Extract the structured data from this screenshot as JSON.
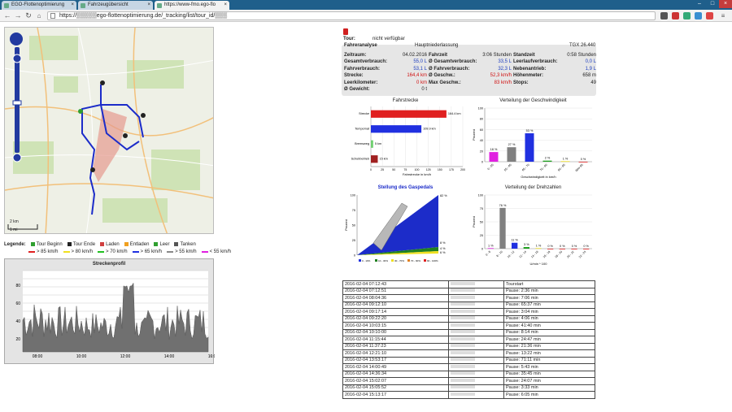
{
  "browser": {
    "tabs": [
      {
        "label": "EGO-Flottenoptimierung",
        "active": false
      },
      {
        "label": "Fahrzeugübersicht",
        "active": false
      },
      {
        "label": "https://www-fmo.ego-flo",
        "active": true
      }
    ],
    "url": "https://▒▒▒▒▒ego-flottenoptimierung.de/_tracking/list/tour_id/▒▒▒"
  },
  "map": {
    "scale_top": "2 km",
    "scale_bottom": "1 mi"
  },
  "legend": {
    "label": "Legende:",
    "items": [
      "Tour Beginn",
      "Tour Ende",
      "Laden",
      "Entladen",
      "Leer",
      "Tanken"
    ],
    "speeds": [
      {
        "label": "> 85 km/h",
        "color": "#e02020"
      },
      {
        "label": "> 80 km/h",
        "color": "#f0e020"
      },
      {
        "label": "> 70 km/h",
        "color": "#20c020"
      },
      {
        "label": "> 65 km/h",
        "color": "#2030e0"
      },
      {
        "label": "> 55 km/h",
        "color": "#888888"
      },
      {
        "label": "< 55 km/h",
        "color": "#e020e0"
      }
    ]
  },
  "profile": {
    "title": "Streckenprofil",
    "yticks": [
      "80",
      "60",
      "40",
      "20"
    ],
    "xticks": [
      "08:00",
      "10:00",
      "12:00",
      "14:00",
      "16:00"
    ]
  },
  "info": {
    "tour_label": "Tour:",
    "tour_value": "nicht verfügbar",
    "fahreranalyse": "Fahreranalyse",
    "location": "Hauptniederlassung",
    "vehicle": "TGX 26.440",
    "col1": [
      {
        "k": "Zeitraum:",
        "v": "04.02.2016",
        "c": ""
      },
      {
        "k": "Gesamtverbrauch:",
        "v": "55,0 L",
        "c": "blue"
      },
      {
        "k": "Fahrverbrauch:",
        "v": "53,1 L",
        "c": "blue"
      },
      {
        "k": "Strecke:",
        "v": "164,4 km",
        "c": "red"
      },
      {
        "k": "Leerkilometer:",
        "v": "0 km",
        "c": "red"
      },
      {
        "k": "Ø Gewicht:",
        "v": "0 t",
        "c": ""
      }
    ],
    "col2": [
      {
        "k": "Fahrzeit",
        "v": "3:06 Stunden",
        "c": ""
      },
      {
        "k": "Ø Gesamtverbrauch:",
        "v": "33,5 L",
        "c": "blue"
      },
      {
        "k": "Ø Fahrverbrauch:",
        "v": "32,3 L",
        "c": "blue"
      },
      {
        "k": "Ø Geschw.:",
        "v": "52,3 km/h",
        "c": "red"
      },
      {
        "k": "Max Geschw.:",
        "v": "83 km/h",
        "c": "red"
      }
    ],
    "col3": [
      {
        "k": "Standzeit",
        "v": "0:58 Stunden",
        "c": ""
      },
      {
        "k": "Leerlaufverbrauch:",
        "v": "0,0 L",
        "c": "blue"
      },
      {
        "k": "Nebenantrieb:",
        "v": "1,9 L",
        "c": "blue"
      },
      {
        "k": "Höhenmeter:",
        "v": "658 m",
        "c": ""
      },
      {
        "k": "Stops:",
        "v": "49",
        "c": ""
      }
    ]
  },
  "chart_data": [
    {
      "type": "bar",
      "title": "Fahrstrecke",
      "xlabel": "Fahrstrecke in km/h",
      "categories": [
        "Strecke",
        "Tempomat",
        "Bremsweg",
        "Schubbetrieb"
      ],
      "values": [
        164.4,
        109.9,
        5,
        15
      ],
      "data_labels": [
        "164.4 km",
        "109.9 km",
        "5 km",
        "15 km"
      ],
      "colors": [
        "#e02020",
        "#2030e0",
        "#70d070",
        "#a02020"
      ],
      "xlim": [
        0,
        200
      ],
      "xticks": [
        "0",
        "25",
        "50",
        "75",
        "100",
        "125",
        "150",
        "175",
        "200"
      ]
    },
    {
      "type": "bar",
      "title": "Verteilung der Geschwindigkeit",
      "xlabel": "Geschwindigkeit in km/h",
      "ylabel": "Prozent",
      "categories": [
        "0 - 55",
        "55 - 65",
        "65 - 70",
        "70 - 80",
        "80 - 85",
        "über 85"
      ],
      "values": [
        18,
        27,
        53,
        2,
        1,
        0
      ],
      "data_labels": [
        "18 %",
        "27 %",
        "53 %",
        "2 %",
        "1 %",
        "0 %"
      ],
      "colors": [
        "#e020e0",
        "#808080",
        "#2030e0",
        "#20a020",
        "#f0e020",
        "#e02020"
      ],
      "ylim": [
        0,
        100
      ],
      "yticks": [
        "0",
        "20",
        "40",
        "60",
        "80",
        "100"
      ]
    },
    {
      "type": "area",
      "title": "Stellung des Gaspedals",
      "ylabel": "Prozent",
      "ylim": [
        0,
        100
      ],
      "yticks": [
        "0",
        "25",
        "50",
        "75",
        "100"
      ],
      "right_labels": [
        "82 %",
        "8 %",
        "4 %",
        "6 %"
      ],
      "legend": [
        "0 - 10%",
        "10 - 30%",
        "30 - 70%",
        "70 - 90%",
        "90 - 100%"
      ],
      "legend_colors": [
        "#2030e0",
        "#208020",
        "#f0e020",
        "#e08020",
        "#e02020"
      ]
    },
    {
      "type": "bar",
      "title": "Verteilung der Drehzahlen",
      "xlabel": "U/min * 100",
      "ylabel": "Prozent",
      "categories": [
        "0 - 8",
        "8 - 10",
        "10 - 12",
        "12 - 14",
        "14 - 16",
        "16 - 18",
        "18 - 20",
        "20 - 22",
        "22 - 24"
      ],
      "values": [
        1,
        76,
        11,
        3,
        1,
        0,
        0,
        0,
        0
      ],
      "data_labels": [
        "1 %",
        "76 %",
        "11 %",
        "3 %",
        "1 %",
        "0 %",
        "0 %",
        "0 %",
        "0 %"
      ],
      "colors": [
        "#e020e0",
        "#808080",
        "#2030e0",
        "#20a020",
        "#f0e020",
        "#e02020",
        "#e02020",
        "#e02020",
        "#e02020"
      ],
      "ylim": [
        0,
        100
      ],
      "yticks": [
        "0",
        "25",
        "50",
        "75",
        "100"
      ]
    }
  ],
  "stops": [
    {
      "time": "2016-02-04 07:12:43",
      "note": "Tourstart"
    },
    {
      "time": "2016-02-04 07:12:51",
      "note": "Pause: 2:36 min"
    },
    {
      "time": "2016-02-04 08:04:36",
      "note": "Pause: 7:06 min"
    },
    {
      "time": "2016-02-04 09:12:10",
      "note": "Pause: 65:37 min"
    },
    {
      "time": "2016-02-04 09:17:14",
      "note": "Pause: 3:04 min"
    },
    {
      "time": "2016-02-04 09:22:20",
      "note": "Pause: 4:06 min"
    },
    {
      "time": "2016-02-04 10:03:15",
      "note": "Pause: 41:40 min"
    },
    {
      "time": "2016-02-04 10:10:00",
      "note": "Pause: 8:14 min"
    },
    {
      "time": "2016-02-04 11:15:44",
      "note": "Pause: 24:47 min"
    },
    {
      "time": "2016-02-04 11:37:23",
      "note": "Pause: 21:36 min"
    },
    {
      "time": "2016-02-04 12:21:10",
      "note": "Pause: 13:22 min"
    },
    {
      "time": "2016-02-04 13:53:17",
      "note": "Pause: 71:11 min"
    },
    {
      "time": "2016-02-04 14:00:49",
      "note": "Pause: 5:43 min"
    },
    {
      "time": "2016-02-04 14:36:34",
      "note": "Pause: 35:45 min"
    },
    {
      "time": "2016-02-04 15:02:07",
      "note": "Pause: 24:07 min"
    },
    {
      "time": "2016-02-04 15:05:52",
      "note": "Pause: 3:33 min"
    },
    {
      "time": "2016-02-04 15:13:17",
      "note": "Pause: 6:05 min"
    }
  ]
}
